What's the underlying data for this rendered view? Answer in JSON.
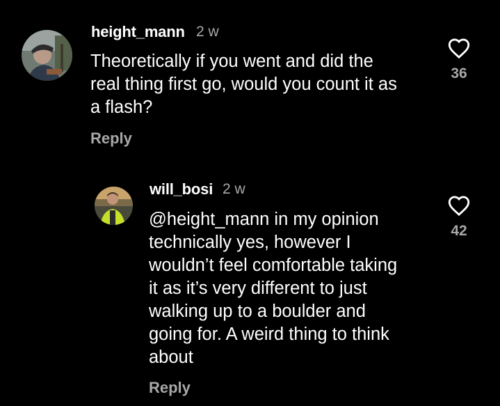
{
  "comments": [
    {
      "username": "height_mann",
      "time": "2 w",
      "body_lines": [
        "Theoretically if you went and did the",
        "real thing first go, would you count it as",
        "a flash?"
      ],
      "reply_label": "Reply",
      "like_count": "36",
      "avatar_icon": "profile-photo",
      "like_icon": "heart-outline-icon"
    },
    {
      "username": "will_bosi",
      "time": "2 w",
      "body_lines": [
        "@height_mann in my opinion",
        "technically yes, however I",
        "wouldn’t feel comfortable taking",
        "it as it’s very different to just",
        "walking up to a boulder and",
        "going for. A weird thing to think",
        "about"
      ],
      "reply_label": "Reply",
      "like_count": "42",
      "avatar_icon": "profile-photo",
      "like_icon": "heart-outline-icon"
    }
  ],
  "colors": {
    "background": "#000000",
    "primary_text": "#ffffff",
    "secondary_text": "#a8a8a8"
  }
}
